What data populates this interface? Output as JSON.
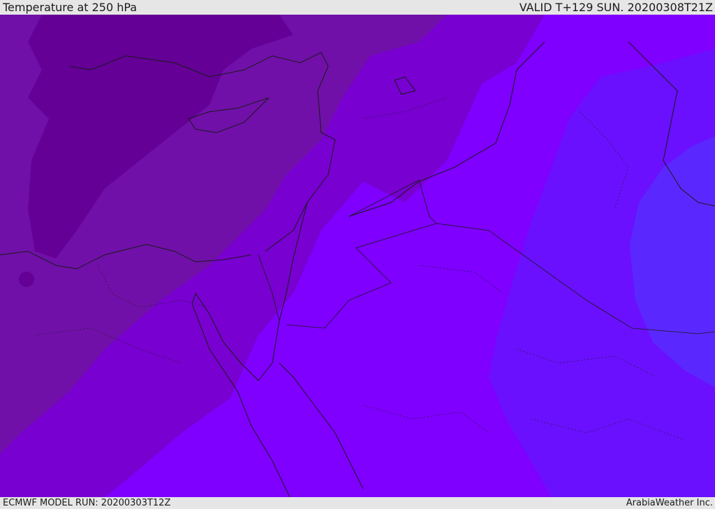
{
  "header": {
    "title": "Temperature at 250 hPa",
    "valid_time": "VALID T+129 SUN. 20200308T21Z"
  },
  "footer": {
    "model_run": "ECMWF MODEL RUN: 20200303T12Z",
    "credit": "ArabiaWeather Inc."
  },
  "map": {
    "variable": "temperature",
    "level": "250 hPa",
    "colors": {
      "band_coldest": "#640096",
      "band_2": "#7010a8",
      "band_3": "#7800d0",
      "band_4": "#7f00ff",
      "band_5": "#6a10ff",
      "band_warmest": "#5a28ff",
      "coastline": "#1a1a1a"
    }
  }
}
